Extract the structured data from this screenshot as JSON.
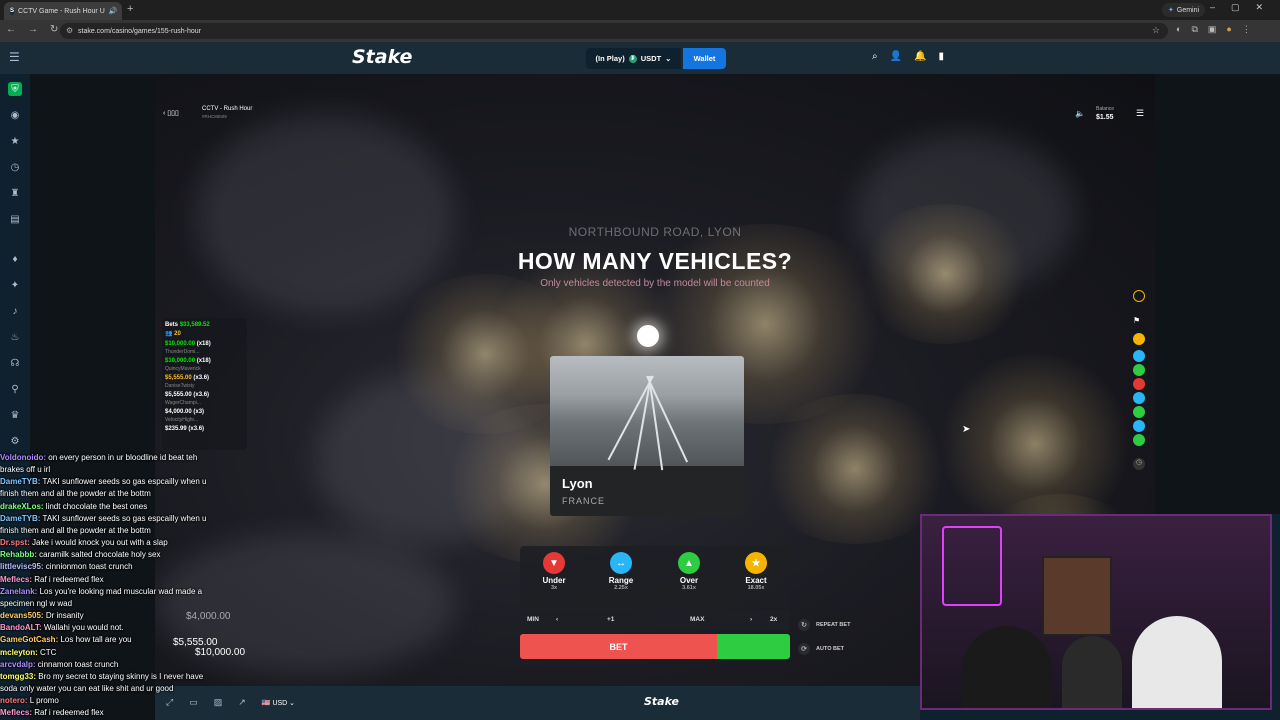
{
  "browser": {
    "tab_title": "CCTV Game - Rush Hour U",
    "tab_favicon": "S",
    "gemini_label": "Gemini",
    "url": "stake.com/casino/games/155-rush-hour"
  },
  "header": {
    "logo": "Stake",
    "balance_label": "(In Play)",
    "currency": "USDT",
    "wallet_label": "Wallet"
  },
  "game": {
    "title": "CCTV - Rush Hour",
    "round_id": "#RHC86509",
    "balance_label": "Balance",
    "balance_value": "$1.55",
    "road_name": "NORTHBOUND ROAD, LYON",
    "question": "HOW MANY VEHICLES?",
    "subtext": "Only vehicles detected by the model will be counted",
    "city": "Lyon",
    "country": "FRANCE"
  },
  "bets_panel": {
    "total_label": "Bets",
    "total_value": "$33,589.52",
    "player_count": "20",
    "entries": [
      {
        "amount": "$10,000.00",
        "mult": "(x18)",
        "user": "ThunderDomi..."
      },
      {
        "amount": "$10,000.00",
        "mult": "(x18)",
        "user": "QuincyMaverick"
      },
      {
        "amount": "$5,555.00",
        "mult": "(x3.6)",
        "user": "DaniseTwisty"
      },
      {
        "amount": "$5,555.00",
        "mult": "(x3.6)",
        "user": "WagerChampi..."
      },
      {
        "amount": "$4,000.00",
        "mult": "(x3)",
        "user": "VelocityHighr..."
      },
      {
        "amount": "$235.99",
        "mult": "(x3.6)",
        "user": ""
      }
    ]
  },
  "floating_bets": [
    "$4,000.00",
    "$5,555.00",
    "$10,000.00"
  ],
  "controls": {
    "options": [
      {
        "label": "Under",
        "mult": "3x"
      },
      {
        "label": "Range",
        "mult": "2.25x"
      },
      {
        "label": "Over",
        "mult": "3.61x"
      },
      {
        "label": "Exact",
        "mult": "18.05x"
      }
    ],
    "min_label": "MIN",
    "step_label": "+1",
    "max_label": "MAX",
    "double_label": "2x",
    "bet_label": "BET",
    "repeat_label": "REPEAT BET",
    "auto_label": "AUTO BET"
  },
  "bottom_bar": {
    "currency": "USD",
    "logo": "Stake"
  },
  "chat": [
    {
      "user": "Voldonoido:",
      "msg": " on every person in ur bloodline id beat teh",
      "color": "#b388ff"
    },
    {
      "user": "",
      "msg": "brakes off u irl",
      "color": "#fff"
    },
    {
      "user": "DameTYB:",
      "msg": " TAKI sunflower seeds so gas espcailly when u",
      "color": "#7ec8ff"
    },
    {
      "user": "",
      "msg": "finish them and all the powder at the bottm",
      "color": "#fff"
    },
    {
      "user": "drakeXLos:",
      "msg": " lindt chocolate the best ones",
      "color": "#7bff7b"
    },
    {
      "user": "DameTYB:",
      "msg": " TAKI sunflower seeds so gas espcailly when u",
      "color": "#7ec8ff"
    },
    {
      "user": "",
      "msg": "finish them and all the powder at the bottm",
      "color": "#fff"
    },
    {
      "user": "Dr.spst:",
      "msg": " Jake i would knock you out with a slap",
      "color": "#ff7777"
    },
    {
      "user": "Rehabbb:",
      "msg": " caramilk salted chocolate holy sex",
      "color": "#7bff7b"
    },
    {
      "user": "littlevisc95:",
      "msg": " cinnionmon toast crunch",
      "color": "#bbbbff"
    },
    {
      "user": "Meflecs:",
      "msg": " Raf i redeemed flex",
      "color": "#ff99cc"
    },
    {
      "user": "Zanelank:",
      "msg": " Los you're looking mad muscular wad made a",
      "color": "#b388ff"
    },
    {
      "user": "",
      "msg": "specimen ngl w wad",
      "color": "#fff"
    },
    {
      "user": "devans505:",
      "msg": " Dr insanity",
      "color": "#ffcc66"
    },
    {
      "user": "BandoALT:",
      "msg": " Wallahi you would not.",
      "color": "#ff99cc"
    },
    {
      "user": "GameGotCash:",
      "msg": " Los how tall are you",
      "color": "#ffcc66"
    },
    {
      "user": "mcleyton:",
      "msg": " CTC",
      "color": "#ffff66"
    },
    {
      "user": "arcvdalp:",
      "msg": " cinnamon toast crunch",
      "color": "#b388ff"
    },
    {
      "user": "tomgg33:",
      "msg": " Bro my secret to staying skinny is I never have",
      "color": "#ffff66"
    },
    {
      "user": "",
      "msg": "soda only water you can eat like shit and ur good",
      "color": "#fff"
    },
    {
      "user": "notero:",
      "msg": " L promo",
      "color": "#ff7777"
    },
    {
      "user": "Meflecs:",
      "msg": " Raf i redeemed flex",
      "color": "#ff99cc"
    }
  ],
  "colors": {
    "stake_dark": "#0f212e",
    "stake_header": "#1a2c38",
    "wallet_blue": "#1475e1",
    "bet_red": "#ef5350",
    "green": "#00e701"
  }
}
